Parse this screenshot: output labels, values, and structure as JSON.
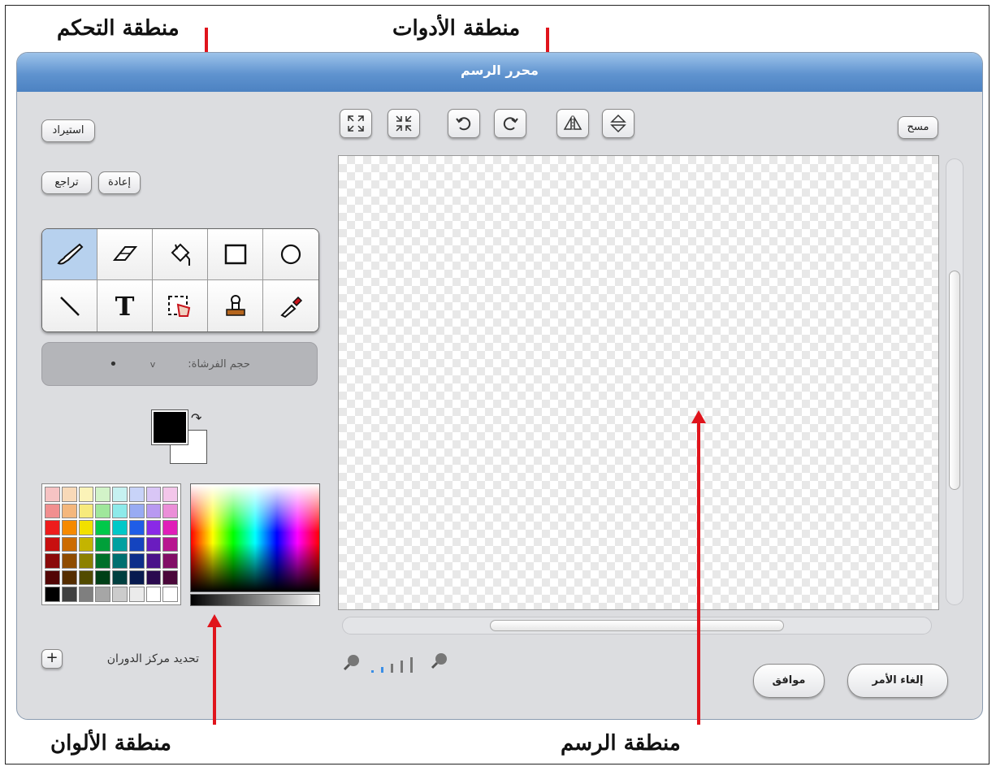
{
  "annotations": {
    "control_area": "منطقة التحكم",
    "tools_area": "منطقة الأدوات",
    "colors_area": "منطقة الألوان",
    "drawing_area": "منطقة الرسم"
  },
  "window": {
    "title": "محرر الرسم"
  },
  "left_panel": {
    "import_label": "استيراد",
    "redo_label": "إعادة",
    "undo_label": "تراجع",
    "brush_size_label": "حجم الفرشاة:",
    "rotation_center_label": "تحديد مركز الدوران"
  },
  "toolbar": {
    "clear_label": "مسح",
    "icons": [
      "grow-icon",
      "shrink-icon",
      "rotate-left-icon",
      "rotate-right-icon",
      "flip-horizontal-icon",
      "flip-vertical-icon"
    ]
  },
  "tools": [
    "brush-icon",
    "eraser-icon",
    "fill-bucket-icon",
    "rectangle-icon",
    "ellipse-icon",
    "line-icon",
    "text-icon",
    "select-icon",
    "stamp-icon",
    "eyedropper-icon"
  ],
  "colors": {
    "foreground": "#000000",
    "background": "#ffffff",
    "palette": [
      "#f6c3c3",
      "#f8d9b8",
      "#fbf3b8",
      "#d2f3c8",
      "#c6f1f1",
      "#c8d3f8",
      "#d9c6f6",
      "#f3c6ea",
      "#f18f8f",
      "#f4b77d",
      "#f7ea7c",
      "#9fe79b",
      "#8eeaea",
      "#98abf3",
      "#b899f1",
      "#eb8fd8",
      "#ee1c1c",
      "#f68a00",
      "#f2e000",
      "#00c94a",
      "#00c8c8",
      "#1f5de7",
      "#8a29e7",
      "#e01fb8",
      "#c80f0f",
      "#cc6b00",
      "#c4b400",
      "#00a03a",
      "#00a0a0",
      "#1444bf",
      "#6a1cbf",
      "#b8168f",
      "#8a0a0a",
      "#8f4c00",
      "#8c8100",
      "#00702a",
      "#007070",
      "#0d2e8a",
      "#4a128a",
      "#820f66",
      "#520505",
      "#552d00",
      "#524b00",
      "#003f17",
      "#003f3f",
      "#071a4f",
      "#2a0a4f",
      "#4a083a",
      "#000000",
      "#404040",
      "#7f7f7f",
      "#a6a6a6",
      "#cccccc",
      "#ebebeb",
      "#ffffff",
      "#ffffff"
    ]
  },
  "buttons": {
    "ok_label": "موافق",
    "cancel_label": "إلغاء الأمر"
  }
}
